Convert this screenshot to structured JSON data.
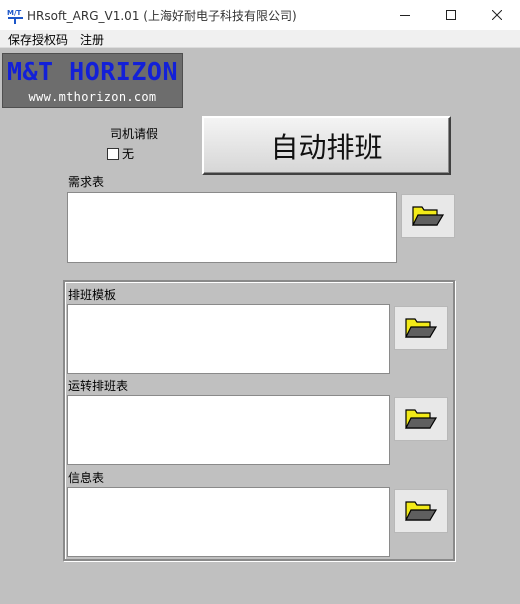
{
  "window": {
    "title": "HRsoft_ARG_V1.01 (上海好耐电子科技有限公司)",
    "minimize_symbol": "—",
    "maximize_symbol": "☐",
    "close_symbol": "✕"
  },
  "menu": {
    "items": [
      {
        "label": "保存授权码"
      },
      {
        "label": "注册"
      }
    ]
  },
  "logo": {
    "main": "M&T HORIZON",
    "url": "www.mthorizon.com",
    "main_color": "#1320d8"
  },
  "leave": {
    "label": "司机请假",
    "checkbox_label": "无",
    "checked": false
  },
  "actions": {
    "auto_schedule_label": "自动排班"
  },
  "fields": {
    "demand": {
      "label": "需求表",
      "value": ""
    },
    "template": {
      "label": "排班模板",
      "value": ""
    },
    "operation": {
      "label": "运转排班表",
      "value": ""
    },
    "info": {
      "label": "信息表",
      "value": ""
    }
  },
  "icons": {
    "folder": "folder-open-icon",
    "folder_color": "#f2ea18"
  }
}
